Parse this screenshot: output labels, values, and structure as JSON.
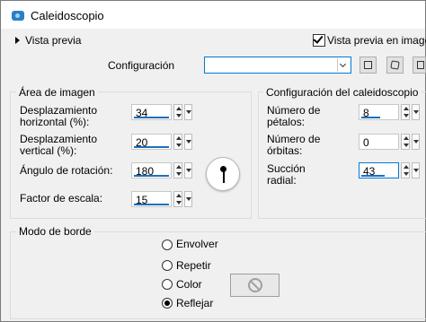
{
  "window": {
    "title": "Caleidoscopio"
  },
  "toolbar": {
    "preview_label": "Vista previa",
    "live_preview_label": "Vista previa en imagen",
    "live_preview_checked": true,
    "config_label": "Configuración",
    "config_value": ""
  },
  "area": {
    "title": "Área de imagen",
    "horizontal_offset": {
      "label": "Desplazamiento horizontal (%):",
      "value": "34"
    },
    "vertical_offset": {
      "label": "Desplazamiento vertical (%):",
      "value": "20"
    },
    "rotation_angle": {
      "label": "Ángulo de rotación:",
      "value": "180"
    },
    "scale_factor": {
      "label": "Factor de escala:",
      "value": "15"
    }
  },
  "kaleido": {
    "title": "Configuración del caleidoscopio",
    "petals": {
      "label": "Número de pétalos:",
      "value": "8"
    },
    "orbits": {
      "label": "Número de órbitas:",
      "value": "0"
    },
    "radial_suction": {
      "label": "Succión radial:",
      "value": "43"
    }
  },
  "border_mode": {
    "title": "Modo de borde",
    "options": [
      "Envolver",
      "Repetir",
      "Color",
      "Reflejar"
    ],
    "selected": "Reflejar"
  }
}
